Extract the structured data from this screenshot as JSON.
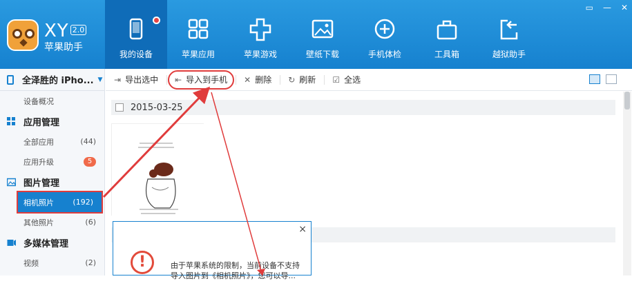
{
  "app": {
    "brand": "XY",
    "version": "2.0",
    "name": "苹果助手"
  },
  "nav": [
    {
      "label": "我的设备",
      "icon": "phone-icon",
      "active": true
    },
    {
      "label": "苹果应用",
      "icon": "apps-grid-icon"
    },
    {
      "label": "苹果游戏",
      "icon": "gamepad-icon"
    },
    {
      "label": "壁纸下载",
      "icon": "wallpaper-icon"
    },
    {
      "label": "手机体检",
      "icon": "health-check-icon"
    },
    {
      "label": "工具箱",
      "icon": "toolbox-icon"
    },
    {
      "label": "越狱助手",
      "icon": "jailbreak-icon"
    }
  ],
  "window_controls": [
    "▭",
    "—",
    "✕"
  ],
  "sidebar": {
    "device": "全泽胜的 iPho...",
    "overview": "设备概况",
    "sections": [
      {
        "title": "应用管理",
        "items": [
          {
            "label": "全部应用",
            "count": "(44)"
          },
          {
            "label": "应用升级",
            "badge": "5"
          }
        ]
      },
      {
        "title": "图片管理",
        "items": [
          {
            "label": "相机照片",
            "count": "(192)",
            "active": true
          },
          {
            "label": "其他照片",
            "count": "(6)"
          }
        ]
      },
      {
        "title": "多媒体管理",
        "items": [
          {
            "label": "视频",
            "count": "(2)"
          }
        ]
      }
    ]
  },
  "toolbar": {
    "export": "导出选中",
    "import": "导入到手机",
    "delete": "删除",
    "refresh": "刷新",
    "select_all": "全选"
  },
  "content": {
    "group_date": "2015-03-25"
  },
  "dialog": {
    "close": "×",
    "icon_text": "!",
    "message": "由于苹果系统的限制，当前设备不支持导入图片到《相机照片》，您可以导..."
  },
  "colors": {
    "header": "#1681cf",
    "accent": "#e03c3c"
  }
}
